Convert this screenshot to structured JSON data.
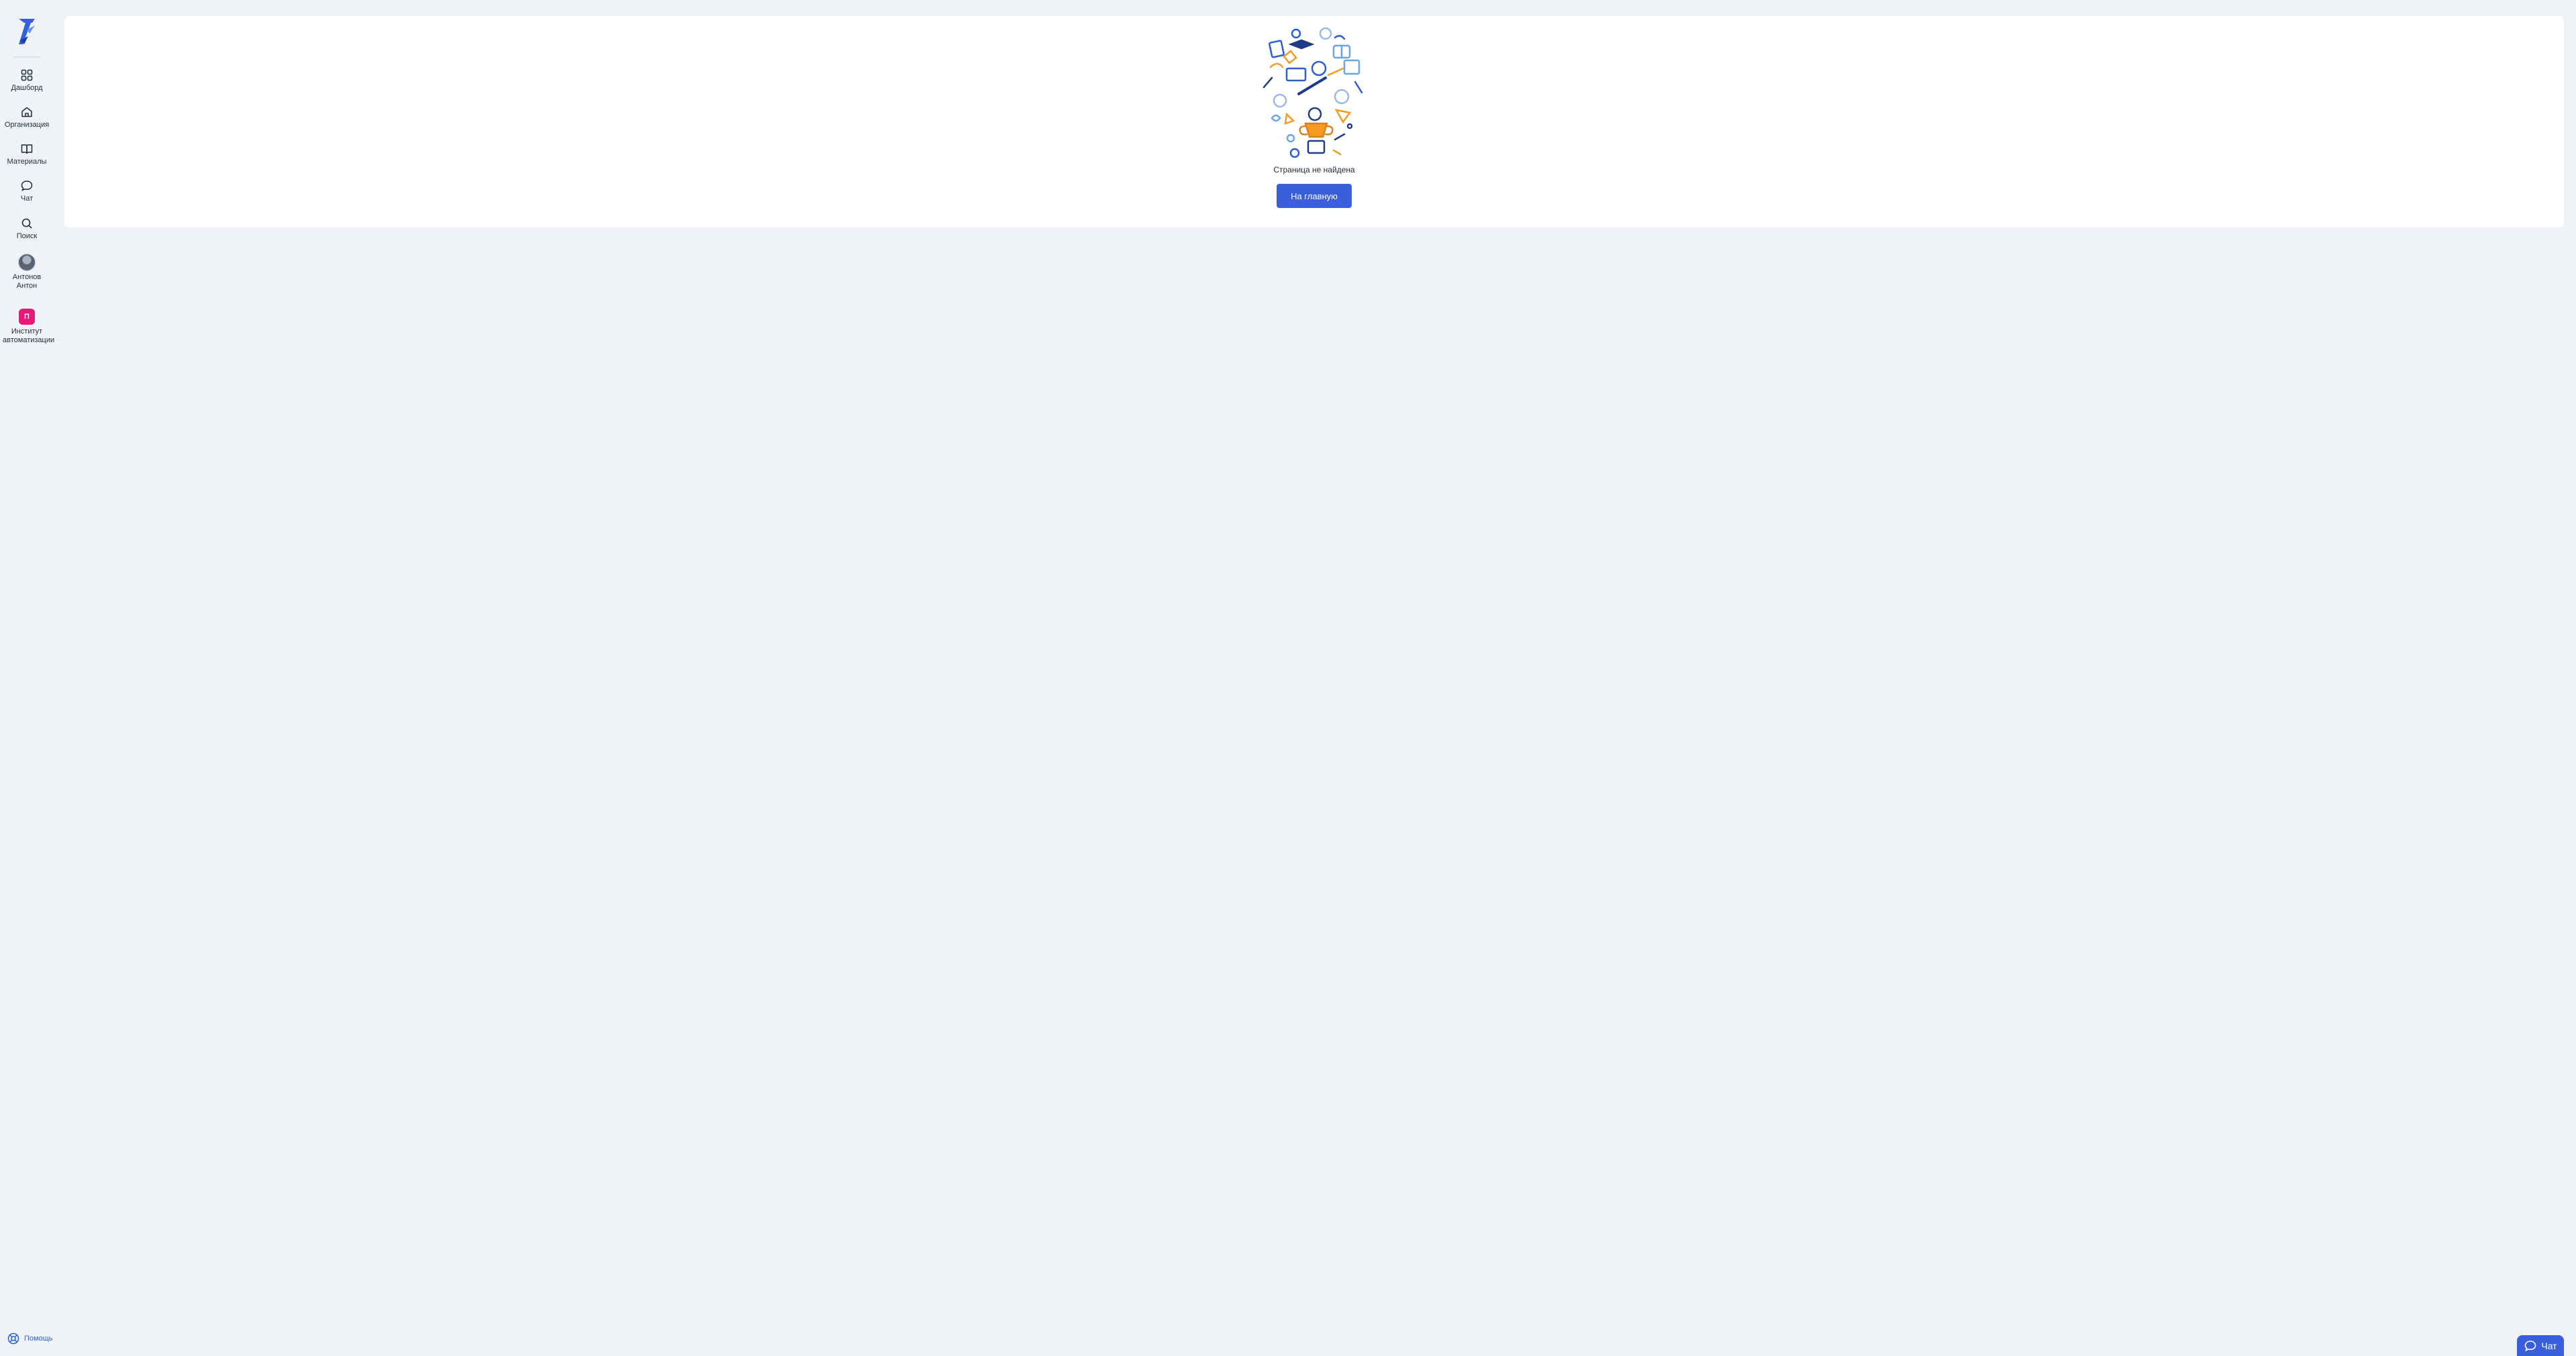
{
  "sidebar": {
    "items": [
      {
        "label": "Дашборд",
        "icon": "grid-icon"
      },
      {
        "label": "Организация",
        "icon": "home-icon"
      },
      {
        "label": "Материалы",
        "icon": "book-icon"
      },
      {
        "label": "Чат",
        "icon": "chat-bubble-icon"
      },
      {
        "label": "Поиск",
        "icon": "search-icon"
      }
    ],
    "profile": {
      "name": "Антонов Антон"
    },
    "organization": {
      "badge": "П",
      "name": "Институт автоматизации",
      "color": "#e6197b"
    },
    "help_label": "Помощь"
  },
  "main": {
    "message": "Страница не найдена",
    "home_button": "На главную"
  },
  "chat_button": {
    "label": "Чат"
  },
  "colors": {
    "accent": "#3b5fdc",
    "background": "#eff3f7",
    "card": "#ffffff"
  }
}
